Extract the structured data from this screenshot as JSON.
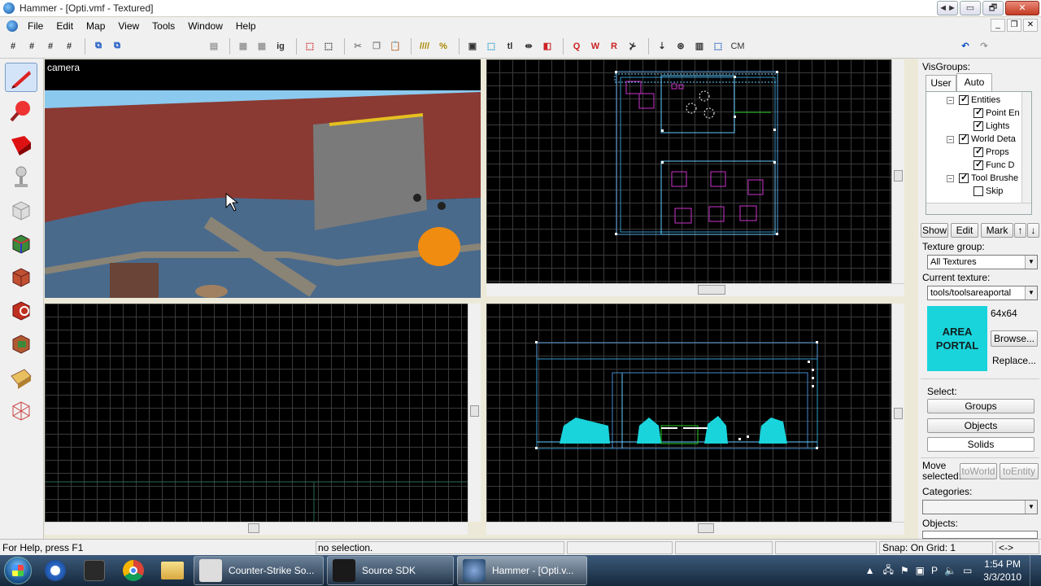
{
  "window": {
    "title": "Hammer - [Opti.vmf - Textured]",
    "controls": [
      "◄►",
      "▭",
      "🗗"
    ]
  },
  "menu": {
    "items": [
      "File",
      "Edit",
      "Map",
      "View",
      "Tools",
      "Window",
      "Help"
    ]
  },
  "toolbar": {
    "text_buttons": [
      "ig",
      "tl",
      "CM"
    ]
  },
  "viewports": {
    "camera_label": "camera"
  },
  "right_panel": {
    "visgroups_label": "VisGroups:",
    "tabs": [
      "User",
      "Auto"
    ],
    "tree": [
      {
        "label": "Entities",
        "checked": true,
        "level": 1,
        "expander": "−"
      },
      {
        "label": "Point En",
        "checked": true,
        "level": 2
      },
      {
        "label": "Lights",
        "checked": true,
        "level": 2
      },
      {
        "label": "World Deta",
        "checked": true,
        "level": 1,
        "expander": "−"
      },
      {
        "label": "Props",
        "checked": true,
        "level": 2
      },
      {
        "label": "Func D",
        "checked": true,
        "level": 2
      },
      {
        "label": "Tool Brushe",
        "checked": true,
        "level": 1,
        "expander": "−"
      },
      {
        "label": "Skip",
        "checked": false,
        "level": 2
      }
    ],
    "buttons": {
      "show": "Show",
      "edit": "Edit",
      "mark": "Mark"
    },
    "texture_group_label": "Texture group:",
    "texture_group_value": "All Textures",
    "current_texture_label": "Current texture:",
    "current_texture_value": "tools/toolsareaportal",
    "texture_preview_text": "AREA PORTAL",
    "texture_preview_color": "#1ad4dc",
    "texture_size": "64x64",
    "browse": "Browse...",
    "replace": "Replace...",
    "select_label": "Select:",
    "select_buttons": [
      "Groups",
      "Objects",
      "Solids"
    ],
    "move_selected_label": "Move selected:",
    "to_world": "toWorld",
    "to_entity": "toEntity",
    "categories_label": "Categories:",
    "objects_label": "Objects:"
  },
  "status": {
    "help": "For Help, press F1",
    "selection": "no selection.",
    "snap": "Snap: On Grid: 1",
    "arrows": "<->"
  },
  "taskbar": {
    "tasks": [
      {
        "label": "Counter-Strike So...",
        "icon": "cs-icon"
      },
      {
        "label": "Source SDK",
        "icon": "steam-icon"
      },
      {
        "label": "Hammer - [Opti.v...",
        "icon": "hammer-icon"
      }
    ],
    "time": "1:54 PM",
    "date": "3/3/2010"
  }
}
